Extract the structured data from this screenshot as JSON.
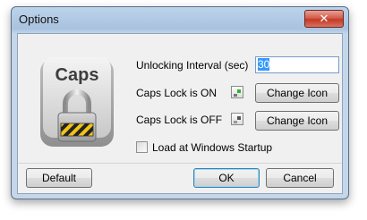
{
  "window": {
    "title": "Options",
    "close_glyph": "✕"
  },
  "logo": {
    "text": "Caps",
    "icon": "caps-lock-padlock-icon"
  },
  "settings": {
    "interval_label": "Unlocking Interval (sec)",
    "interval_value": "30",
    "caps_on_label": "Caps Lock is ON",
    "caps_off_label": "Caps Lock is OFF",
    "change_icon_label": "Change Icon",
    "startup_label": "Load at Windows Startup",
    "startup_checked": false,
    "on_indicator_color": "#2fb52f",
    "off_indicator_color": "#555555"
  },
  "footer": {
    "default_label": "Default",
    "ok_label": "OK",
    "cancel_label": "Cancel"
  }
}
